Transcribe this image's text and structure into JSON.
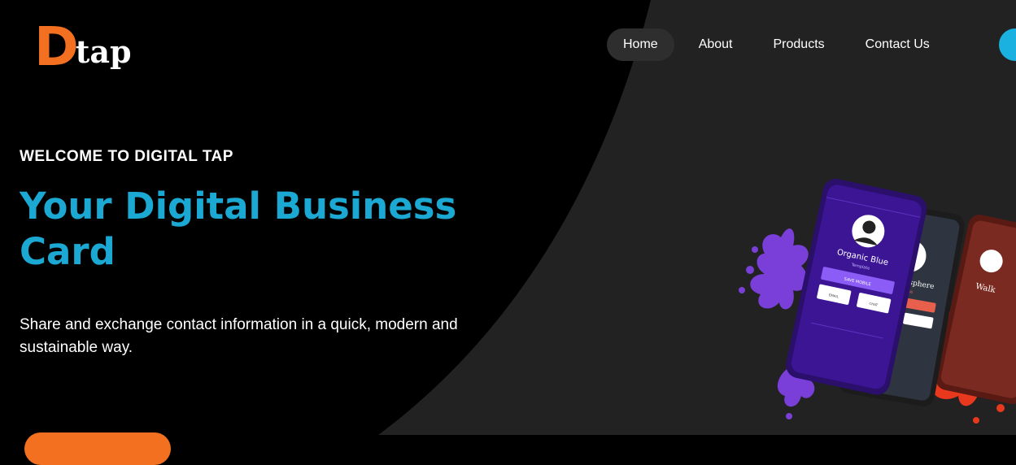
{
  "brand": {
    "logo_letter": "D",
    "logo_word": "tap",
    "logo_letter_color": "#f37021"
  },
  "nav": {
    "items": [
      {
        "label": "Home",
        "active": true
      },
      {
        "label": "About",
        "active": false
      },
      {
        "label": "Products",
        "active": false
      },
      {
        "label": "Contact Us",
        "active": false
      }
    ]
  },
  "hero": {
    "eyebrow": "WELCOME TO DIGITAL TAP",
    "headline": "Your Digital Business Card",
    "description": "Share and exchange contact information in a quick, modern and sustainable way."
  },
  "phones": {
    "front": {
      "name": "Organic Blue",
      "subtitle": "Template",
      "save_label": "SAVE MOBILE",
      "email_label": "EMAIL",
      "chat_label": "CHAT"
    },
    "middle": {
      "name": "dulating sphere",
      "subtitle": "Template"
    },
    "back": {
      "name": "Walk"
    }
  },
  "colors": {
    "accent": "#1ba8d3",
    "orange": "#f37021",
    "purple": "#7c3aed",
    "red": "#e8381e"
  }
}
